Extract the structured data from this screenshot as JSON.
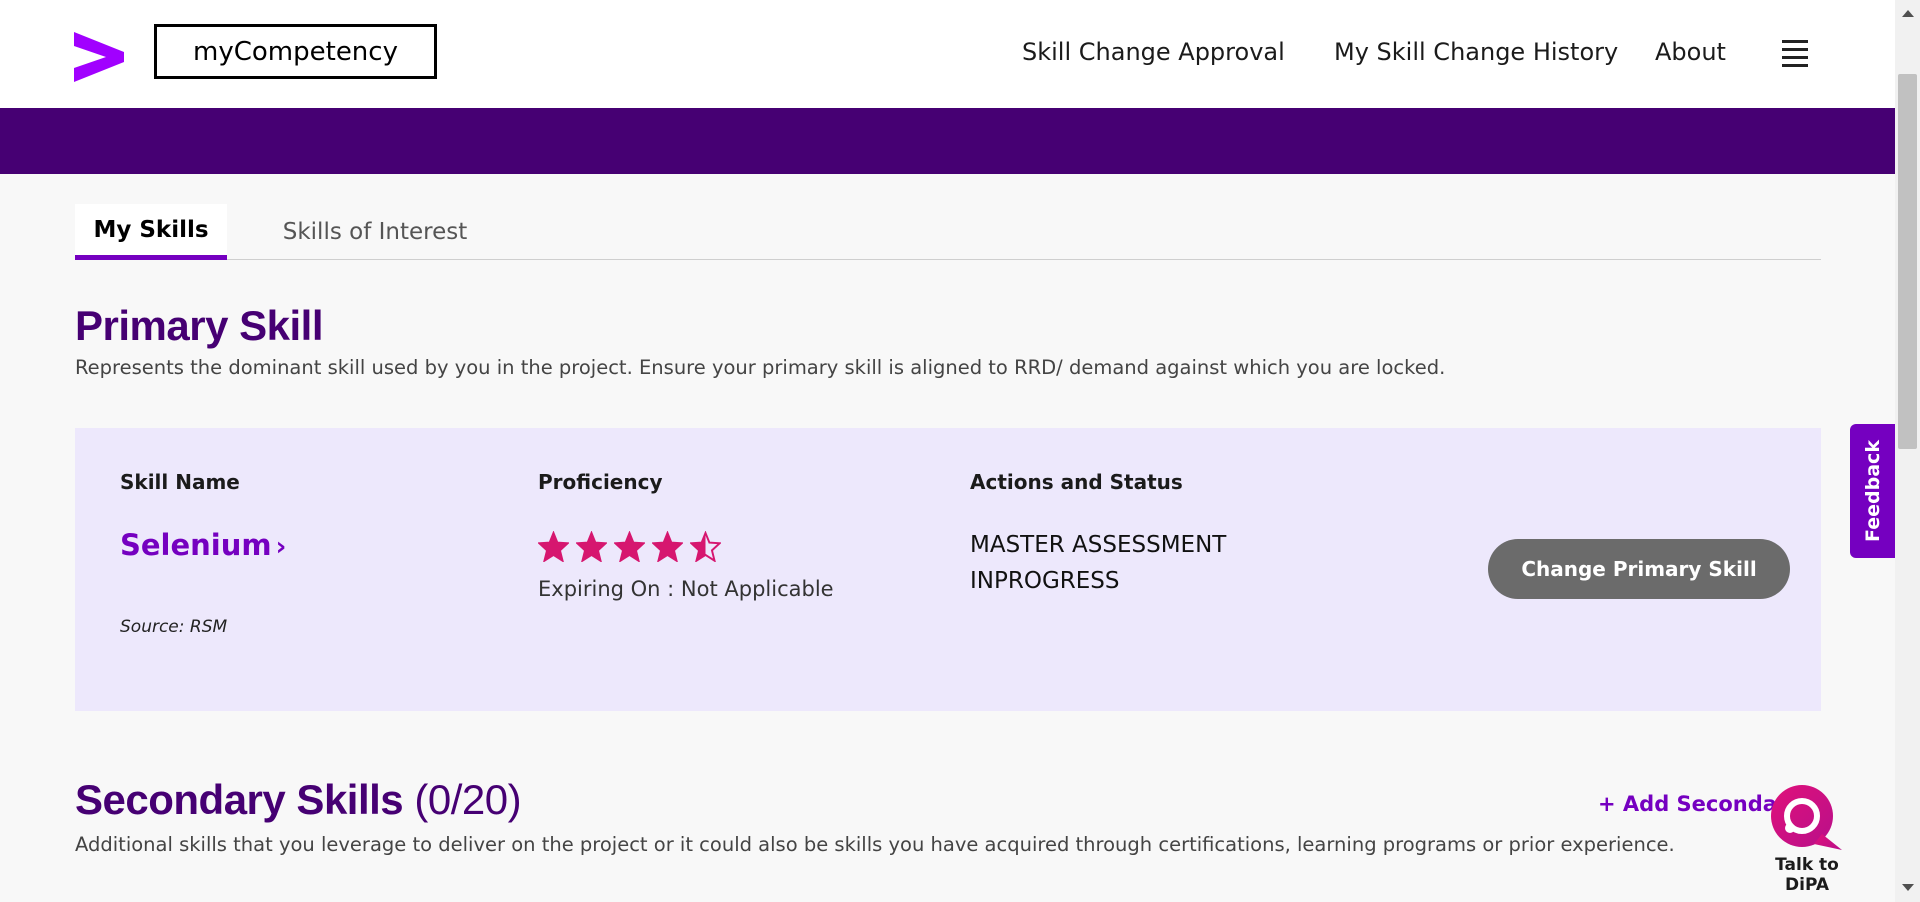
{
  "header": {
    "brand": "myCompetency",
    "nav": [
      "Skill Change Approval",
      "My Skill Change History",
      "About"
    ],
    "accent_color": "#460073",
    "icons": {
      "logo": "accenture-chevron-logo",
      "menu": "hamburger-menu-icon"
    }
  },
  "tabs": {
    "items": [
      "My Skills",
      "Skills of Interest"
    ],
    "active": "My Skills"
  },
  "primary": {
    "title": "Primary Skill",
    "description": "Represents the dominant skill used by you in the project. Ensure your primary skill is aligned to RRD/ demand against which you are locked.",
    "col_skill": "Skill Name",
    "col_proficiency": "Proficiency",
    "col_actions": "Actions and Status",
    "skill_name": "Selenium",
    "source": "Source: RSM",
    "rating": 4.5,
    "rating_max": 5,
    "expiry": "Expiring On : Not Applicable",
    "status_line1": "MASTER ASSESSMENT",
    "status_line2": "INPROGRESS",
    "change_button": "Change Primary Skill",
    "star_color": "#d6166f"
  },
  "feedback": "Feedback",
  "secondary": {
    "title": "Secondary Skills",
    "count": "(0/20)",
    "description": "Additional skills that you leverage to deliver on the project or it could also be skills you have acquired through certifications, learning programs or prior experience.",
    "add_link": "+ Add Secondary"
  },
  "dipa": {
    "label": "Talk to DiPA",
    "icon": "chat-assistant-icon"
  }
}
